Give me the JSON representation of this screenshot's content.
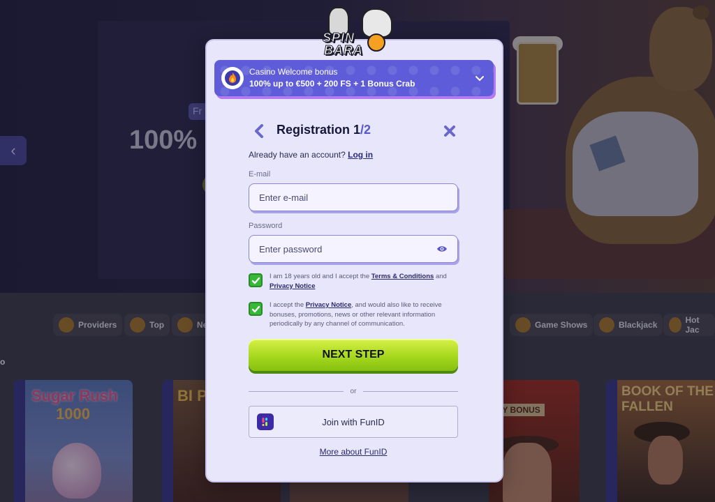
{
  "background": {
    "hero_pill": "Fr",
    "hero_text": "100%",
    "nav_chips": [
      {
        "label": "Providers"
      },
      {
        "label": "Top"
      },
      {
        "label": "Ne"
      },
      {
        "label": "Game Shows"
      },
      {
        "label": "Blackjack"
      },
      {
        "label": "Hot Jac"
      }
    ],
    "section_mark": "o",
    "games": {
      "sugar_rush_title": "Sugar Rush",
      "sugar_rush_number": "1000",
      "second_title": "BI PI",
      "book_label": "TY BONUS",
      "fallen_title": "BOOK OF THE FALLEN"
    }
  },
  "logo": {
    "line1": "SPIN",
    "line2": "BARA"
  },
  "bonus": {
    "title": "Casino Welcome bonus",
    "offer": "100% up to €500 + 200 FS + 1 Bonus Crab"
  },
  "registration": {
    "title": "Registration 1",
    "step_total": "/2",
    "already_text": "Already have an account?",
    "login_link": "Log in"
  },
  "email": {
    "label": "E-mail",
    "placeholder": "Enter e-mail"
  },
  "password": {
    "label": "Password",
    "placeholder": "Enter password"
  },
  "consent_terms": {
    "checked": true,
    "text_before": "I am 18 years old and I accept the",
    "terms_link": "Terms & Conditions",
    "and": "and",
    "privacy_link": "Privacy Notice"
  },
  "consent_marketing": {
    "checked": true,
    "text_before": "I accept the",
    "privacy_link": "Privacy Notice",
    "text_after": ", and would also like to receive bonuses, promotions, news or other relevant information periodically by any channel of communication."
  },
  "next_button": "NEXT STEP",
  "divider": "or",
  "funid_button": "Join with FunID",
  "funid_link": "More about FunID",
  "colors": {
    "modal_bg": "#e8e6fa",
    "bonus_bg": "#5e5cd8",
    "checkbox": "#38b838",
    "primary_button": "#a6d81e"
  }
}
